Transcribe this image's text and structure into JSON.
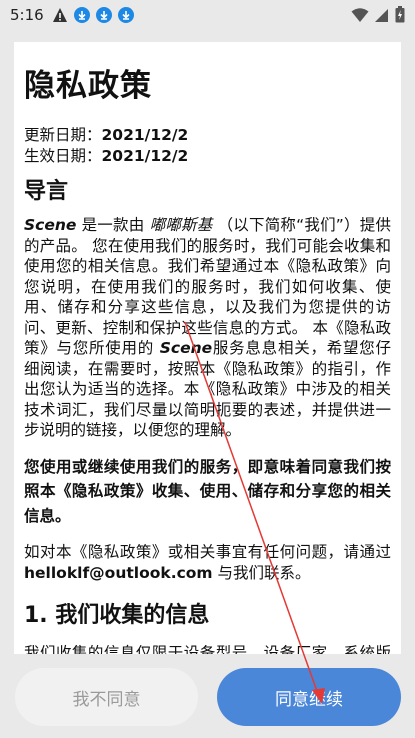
{
  "status_bar": {
    "time": "5:16"
  },
  "policy": {
    "title": "隐私政策",
    "update_label": "更新日期：",
    "update_date": "2021/12/2",
    "effective_label": "生效日期：",
    "effective_date": "2021/12/2",
    "section_intro": "导言",
    "p1_app": "Scene",
    "p1_a": " 是一款由 ",
    "p1_dev": "嘟嘟斯基",
    "p1_b": " （以下简称“我们”）提供的产品。 您在使用我们的服务时，我们可能会收集和使用您的相关信息。我们希望通过本《隐私政策》向您说明，在使用我们的服务时，我们如何收集、使用、储存和分享这些信息，以及我们为您提供的访问、更新、控制和保护这些信息的方式。 本《隐私政策》与您所使用的 ",
    "p1_app2": "Scene",
    "p1_c": "服务息息相关，希望您仔细阅读，在需要时，按照本《隐私政策》的指引，作出您认为适当的选择。本《隐私政策》中涉及的相关技术词汇，我们尽量以简明扼要的表述，并提供进一步说明的链接，以便您的理解。",
    "p2": "您使用或继续使用我们的服务，即意味着同意我们按照本《隐私政策》收集、使用、储存和分享您的相关信息。",
    "p3_a": "如对本《隐私政策》或相关事宜有任何问题，请通过 ",
    "p3_email": "helloklf@outlook.com",
    "p3_b": " 与我们联系。",
    "section1": "1. 我们收集的信息",
    "p4": "我们收集的信息仅限于设备型号、设备厂家、系统版本：设备ID信息、硬件配置参数：性能统"
  },
  "buttons": {
    "disagree": "我不同意",
    "agree": "同意继续"
  },
  "colors": {
    "accent": "#4b87d8",
    "download_icon": "#1e88e5",
    "annotation_arrow": "#e53935"
  }
}
